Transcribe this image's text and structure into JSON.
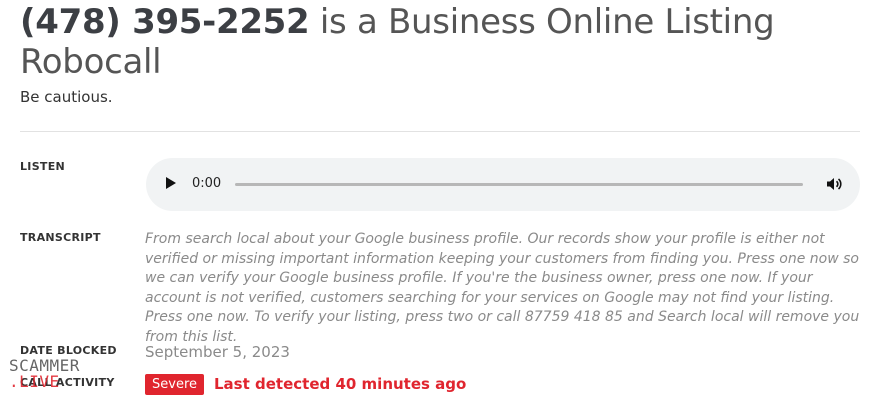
{
  "header": {
    "phone_number": "(478) 395-2252",
    "title_rest": " is a Business Online Listing Robocall",
    "subtitle": "Be cautious."
  },
  "listen": {
    "label": "LISTEN",
    "time": "0:00",
    "progress": 0
  },
  "transcript": {
    "label": "TRANSCRIPT",
    "text": "From search local about your Google business profile. Our records show your profile is either not verified or missing important information keeping your customers from finding you. Press one now so we can verify your Google business profile. If you're the business owner, press one now. If your account is not verified, customers searching for your services on Google may not find your listing. Press one now. To verify your listing, press two or call 87759 418 85 and Search local will remove you from this list."
  },
  "date_blocked": {
    "label": "DATE BLOCKED",
    "value": "September 5, 2023"
  },
  "call_activity": {
    "label": "CALL ACTIVITY",
    "severity": "Severe",
    "last_detected": "Last detected 40 minutes ago"
  },
  "watermark": {
    "line1": "SCAMMER",
    "line2": ".LIVE"
  },
  "colors": {
    "severe": "#e0252e",
    "muted_text": "#8a8a8a",
    "player_bg": "#f1f3f4"
  }
}
